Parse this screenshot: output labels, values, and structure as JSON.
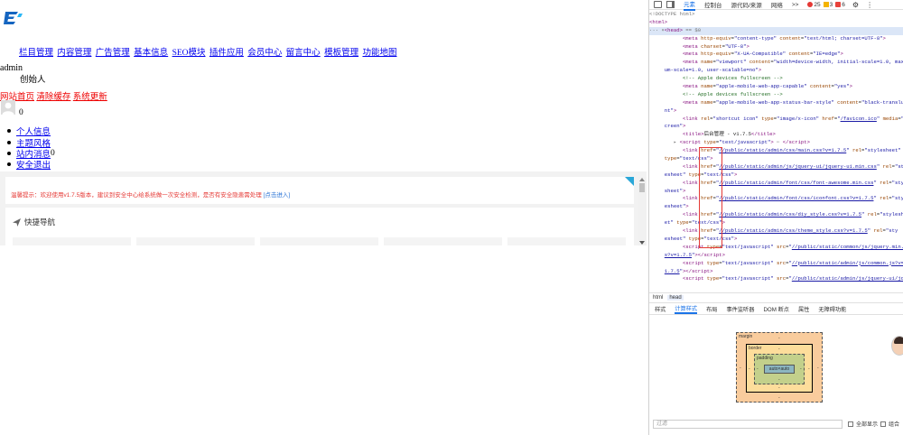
{
  "page": {
    "top_nav": [
      "栏目管理",
      "内容管理",
      "广告管理",
      "基本信息",
      "SEO模块",
      "插件应用",
      "会员中心",
      "留言中心",
      "模板管理",
      "功能地图"
    ],
    "admin_name": "admin",
    "role": "创始人",
    "quick_links": [
      "网站首页",
      "清除缓存",
      "系统更新"
    ],
    "avatar_count": "0",
    "user_menu": [
      "个人信息",
      "主题风格",
      "站内消息",
      "安全退出"
    ],
    "message_badge": "0",
    "notice_text": "温馨提示：欢迎使用v1.7.5版本，建议到安全中心给系统做一次安全检测，是否有安全隐患需处理 ",
    "notice_link": "[点击进入]",
    "quicknav_title": "快捷导航"
  },
  "devtools": {
    "tabs": [
      "元素",
      "控制台",
      "源代码/来源",
      "网络",
      ">>"
    ],
    "active_tab": "元素",
    "error_count": "25",
    "warning_count": "3",
    "issue_count": "6",
    "breadcrumbs": [
      "html",
      "head"
    ],
    "sub_tabs": [
      "样式",
      "计算样式",
      "布局",
      "事件监听器",
      "DOM 断点",
      "属性",
      "无障碍功能"
    ],
    "active_sub_tab": "计算样式",
    "filter_placeholder": "过滤",
    "show_all_label": "全部显示",
    "group_label": "组合",
    "box_model": {
      "margin": "margin",
      "border": "border",
      "padding": "padding",
      "content": "auto×auto",
      "dash": "-"
    }
  },
  "colors": {
    "accent": "#1a73e8",
    "link": "#0000ee",
    "red_link": "#ee0000",
    "notice": "#e53935",
    "error": "#e53935",
    "warning": "#f4b400",
    "issue": "#e8423a"
  },
  "icons": [
    "element-picker-icon",
    "device-toolbar-icon",
    "settings-icon",
    "quicknav-icon",
    "logo-icon"
  ]
}
